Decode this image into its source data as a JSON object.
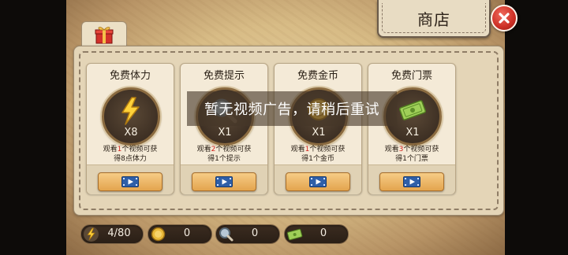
{
  "shop": {
    "title": "商店"
  },
  "toast": "暂无视频广告，请稍后重试",
  "cards": [
    {
      "title": "免费体力",
      "multiplier": "X8",
      "desc_pre": "观看",
      "desc_count": "1",
      "desc_post": "个视频可获",
      "desc_reward": "得8点体力",
      "icon": "lightning-icon"
    },
    {
      "title": "免费提示",
      "multiplier": "X1",
      "desc_pre": "观看",
      "desc_count": "2",
      "desc_post": "个视频可获",
      "desc_reward": "得1个提示",
      "icon": "magnifier-icon"
    },
    {
      "title": "免费金币",
      "multiplier": "X1",
      "desc_pre": "观看",
      "desc_count": "1",
      "desc_post": "个视频可获",
      "desc_reward": "得1个金币",
      "icon": "coin-icon"
    },
    {
      "title": "免费门票",
      "multiplier": "X1",
      "desc_pre": "观看",
      "desc_count": "3",
      "desc_post": "个视频可获",
      "desc_reward": "得1个门票",
      "icon": "ticket-icon"
    }
  ],
  "stats": {
    "energy": "4/80",
    "coins": "0",
    "hints": "0",
    "tickets": "0"
  },
  "colors": {
    "highlight": "#d3241c",
    "close": "#cc2f25",
    "button": "#e3a44e"
  }
}
